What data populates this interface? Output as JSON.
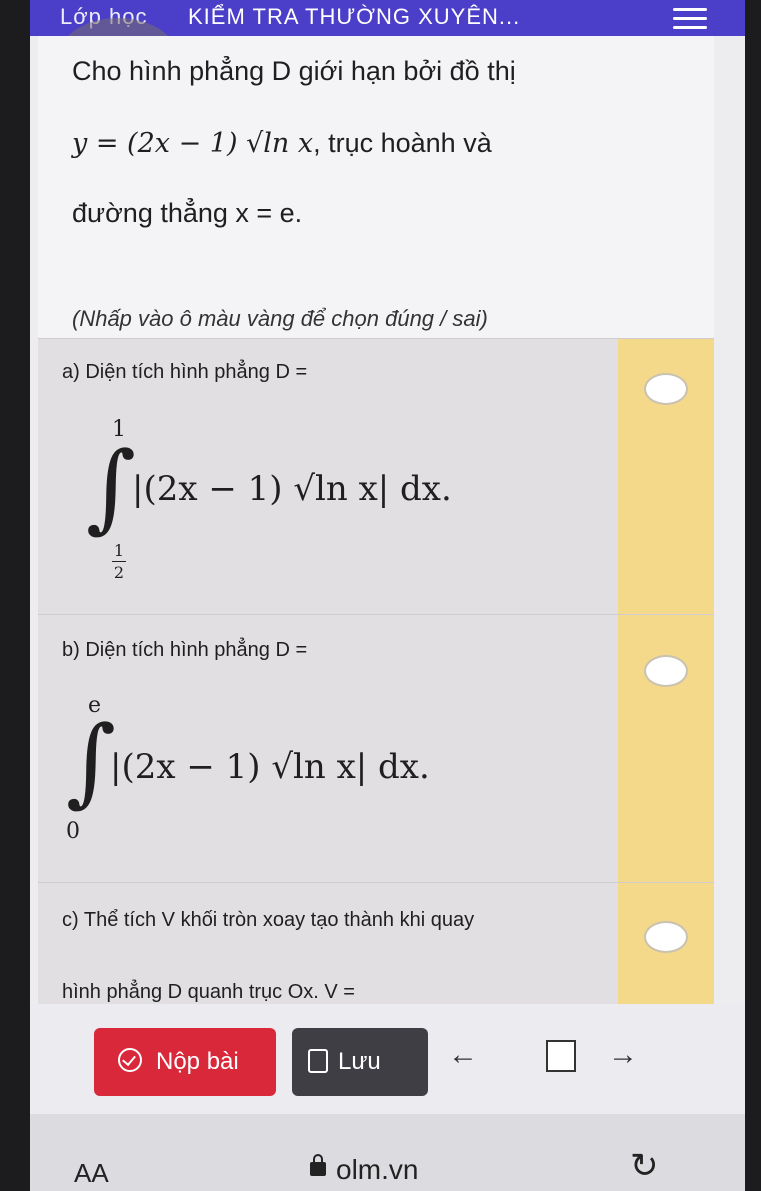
{
  "header": {
    "breadcrumb": "Lớp học",
    "title": "KIỂM TRA THƯỜNG XUYÊN..."
  },
  "question": {
    "line1": "Cho hình phẳng D giới hạn bởi đồ thị",
    "line2_math": "y = (2x − 1) √ln x",
    "line2_text": ", trục hoành và",
    "line3": "đường thẳng x = e.",
    "hint": "(Nhấp vào ô màu vàng để chọn đúng / sai)"
  },
  "options": [
    {
      "label": "a) Diện tích hình phẳng D =",
      "upper": "1",
      "lower_num": "1",
      "lower_den": "2",
      "integrand": "|(2x − 1) √ln x| dx."
    },
    {
      "label": "b) Diện tích hình phẳng D =",
      "upper": "e",
      "lower": "0",
      "integrand": "|(2x − 1) √ln x| dx."
    },
    {
      "label": "c) Thể tích V khối tròn xoay tạo thành khi quay",
      "label2": "hình phẳng D quanh trục Ox. V ="
    }
  ],
  "actions": {
    "submit_label": "Nộp bài",
    "save_label": "Lưu"
  },
  "browser": {
    "text_size": "AA",
    "url": "olm.vn"
  },
  "colors": {
    "header": "#4b3fc9",
    "submit": "#d9283a",
    "save": "#3e3e44",
    "choice": "#f4d98a"
  }
}
